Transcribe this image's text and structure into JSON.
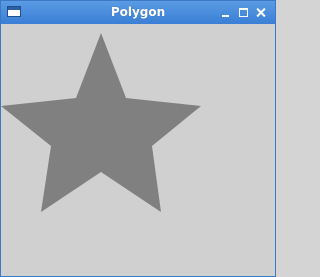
{
  "window": {
    "title": "Polygon",
    "controls": [
      "minimize-icon",
      "maximize-icon",
      "close-icon"
    ]
  },
  "canvas": {
    "background": "#d0d0d0",
    "shape": {
      "type": "star",
      "points": 5,
      "fill": "#808080"
    }
  },
  "colors": {
    "titlebar": "#4a8ddc",
    "border": "#3c78c4"
  }
}
